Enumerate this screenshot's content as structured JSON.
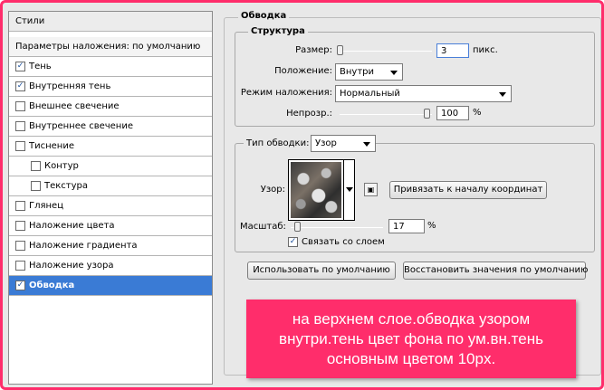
{
  "styles_panel": {
    "header": "Стили",
    "blending_options": "Параметры наложения: по умолчанию",
    "items": [
      {
        "label": "Тень",
        "checked": true,
        "indent": false,
        "selected": false
      },
      {
        "label": "Внутренняя тень",
        "checked": true,
        "indent": false,
        "selected": false
      },
      {
        "label": "Внешнее свечение",
        "checked": false,
        "indent": false,
        "selected": false
      },
      {
        "label": "Внутреннее свечение",
        "checked": false,
        "indent": false,
        "selected": false
      },
      {
        "label": "Тиснение",
        "checked": false,
        "indent": false,
        "selected": false
      },
      {
        "label": "Контур",
        "checked": false,
        "indent": true,
        "selected": false
      },
      {
        "label": "Текстура",
        "checked": false,
        "indent": true,
        "selected": false
      },
      {
        "label": "Глянец",
        "checked": false,
        "indent": false,
        "selected": false
      },
      {
        "label": "Наложение цвета",
        "checked": false,
        "indent": false,
        "selected": false
      },
      {
        "label": "Наложение градиента",
        "checked": false,
        "indent": false,
        "selected": false
      },
      {
        "label": "Наложение узора",
        "checked": false,
        "indent": false,
        "selected": false
      },
      {
        "label": "Обводка",
        "checked": true,
        "indent": false,
        "selected": true
      }
    ]
  },
  "stroke": {
    "title": "Обводка",
    "structure": {
      "title": "Структура",
      "size_label": "Размер:",
      "size_value": "3",
      "size_unit": "пикс.",
      "position_label": "Положение:",
      "position_value": "Внутри",
      "blend_label": "Режим наложения:",
      "blend_value": "Нормальный",
      "opacity_label": "Непрозр.:",
      "opacity_value": "100",
      "opacity_unit": "%"
    },
    "fill": {
      "type_label": "Тип обводки:",
      "type_value": "Узор",
      "pattern_label": "Узор:",
      "snap_button": "Привязать к началу координат",
      "scale_label": "Масштаб:",
      "scale_value": "17",
      "scale_unit": "%",
      "link_label": "Связать со слоем",
      "link_checked": true
    },
    "default_button": "Использовать по умолчанию",
    "reset_button": "Восстановить значения по умолчанию"
  },
  "note": {
    "lines": [
      "на верхнем слое.обводка узором",
      "внутри.тень цвет фона по ум.вн.тень",
      "основным цветом 10px."
    ]
  },
  "colors": {
    "accent_pink": "#ff2d6b",
    "selected_row": "#3a7bd5"
  },
  "icons": {
    "checkbox_checked": "check-icon",
    "dropdown": "chevron-down-icon",
    "new_preset": "new-preset-icon"
  }
}
